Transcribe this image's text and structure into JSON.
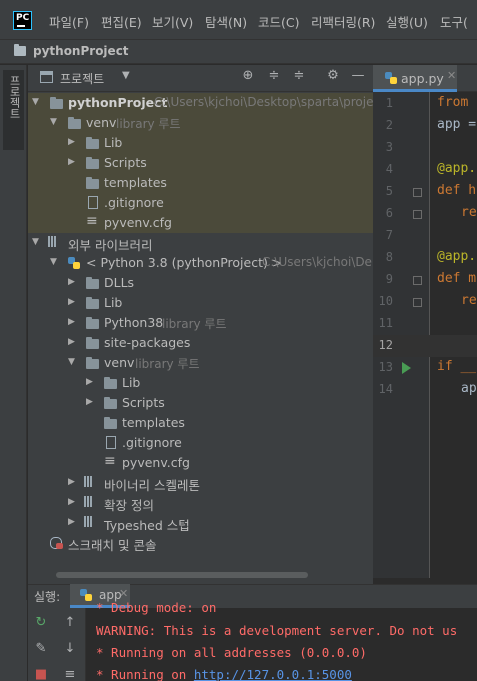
{
  "menu": [
    {
      "label": "파일(F)"
    },
    {
      "label": "편집(E)"
    },
    {
      "label": "보기(V)"
    },
    {
      "label": "탐색(N)"
    },
    {
      "label": "코드(C)"
    },
    {
      "label": "리팩터링(R)"
    },
    {
      "label": "실행(U)"
    },
    {
      "label": "도구("
    }
  ],
  "app_logo": "PC",
  "breadcrumb": "pythonProject",
  "tool_stripe_label": "프로젝트",
  "project_panel": {
    "title": "프로젝트",
    "icons": [
      "crosshair-icon",
      "expand-all-icon",
      "collapse-all-icon",
      "gear-icon",
      "hide-icon"
    ]
  },
  "tree": [
    {
      "label": "pythonProject",
      "hint": "C:\\Users\\kjchoi\\Desktop\\sparta\\proje",
      "bold": true
    },
    {
      "label": "venv",
      "hint": "library 루트"
    },
    {
      "label": "Lib"
    },
    {
      "label": "Scripts"
    },
    {
      "label": "templates"
    },
    {
      "label": ".gitignore"
    },
    {
      "label": "pyvenv.cfg"
    },
    {
      "label": "외부 라이브러리"
    },
    {
      "label": "< Python 3.8 (pythonProject) >",
      "hint": "C:\\Users\\kjchoi\\De"
    },
    {
      "label": "DLLs"
    },
    {
      "label": "Lib"
    },
    {
      "label": "Python38",
      "hint": "library 루트"
    },
    {
      "label": "site-packages"
    },
    {
      "label": "venv",
      "hint": "library 루트"
    },
    {
      "label": "Lib"
    },
    {
      "label": "Scripts"
    },
    {
      "label": "templates"
    },
    {
      "label": ".gitignore"
    },
    {
      "label": "pyvenv.cfg"
    },
    {
      "label": "바이너리 스켈레톤"
    },
    {
      "label": "확장 정의"
    },
    {
      "label": "Typeshed 스텁"
    },
    {
      "label": "스크래치 및 콘솔"
    }
  ],
  "editor": {
    "tab_label": "app.py",
    "line_numbers": [
      "1",
      "2",
      "3",
      "4",
      "5",
      "6",
      "7",
      "8",
      "9",
      "10",
      "11",
      "12",
      "13",
      "14"
    ],
    "current_line": "12",
    "code": {
      "l1": "from",
      "l2": "app =",
      "l4": "@app.",
      "l5": "def h",
      "l6": "re",
      "l8": "@app.",
      "l9": "def m",
      "l10": "re",
      "l13": "if __",
      "l14": "ap"
    }
  },
  "run_panel": {
    "label": "실행:",
    "tab_label": "app",
    "lines": [
      "* Debug mode: on",
      "WARNING: This is a development server. Do not us",
      " * Running on all addresses (0.0.0.0)",
      " * Running on "
    ],
    "url": "http://127.0.0.1:5000"
  },
  "colors": {
    "accent": "#4a88c7",
    "keyword": "#cc7832",
    "decorator": "#bbb529",
    "error": "#ff6b68",
    "link": "#5894e6"
  }
}
